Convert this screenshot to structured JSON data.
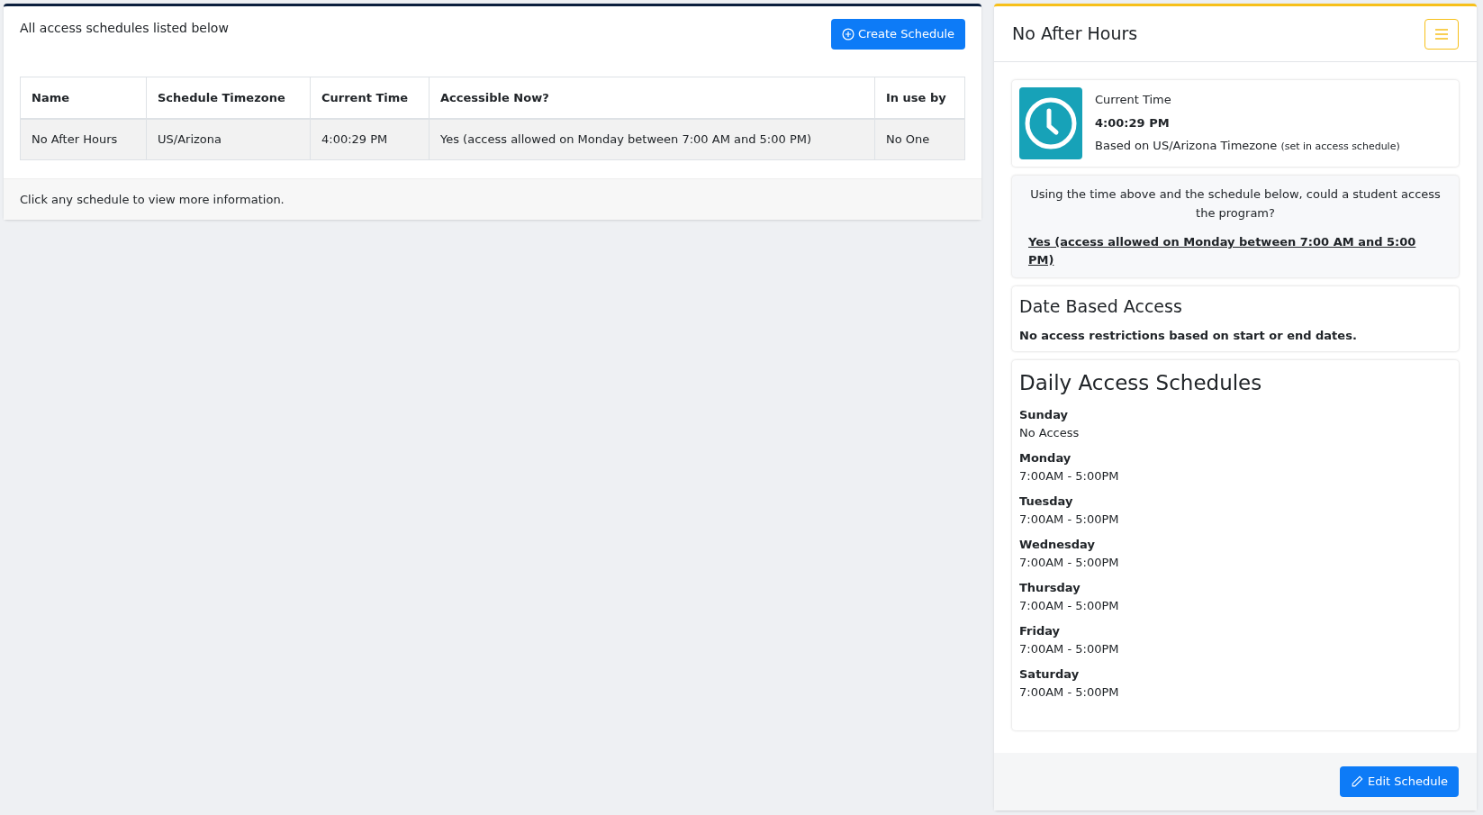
{
  "schedules_panel": {
    "heading": "All access schedules listed below",
    "create_button": "Create Schedule",
    "table": {
      "columns": [
        "Name",
        "Schedule Timezone",
        "Current Time",
        "Accessible Now?",
        "In use by"
      ],
      "rows": [
        [
          "No After Hours",
          "US/Arizona",
          "4:00:29 PM",
          "Yes (access allowed on Monday between 7:00 AM and 5:00 PM)",
          "No One"
        ]
      ]
    },
    "footer": "Click any schedule to view more information."
  },
  "detail_panel": {
    "title": "No After Hours",
    "time_card": {
      "label": "Current Time",
      "time": "4:00:29 PM",
      "timezone_note": "Based on US/Arizona Timezone",
      "timezone_aside": "(set in access schedule)"
    },
    "access_card": {
      "question": "Using the time above and the schedule below, could a student access the program?",
      "answer": "Yes (access allowed on Monday between 7:00 AM and 5:00 PM)"
    },
    "date_card": {
      "title": "Date Based Access",
      "text": "No access restrictions based on start or end dates."
    },
    "daily_card": {
      "title": "Daily Access Schedules",
      "days": [
        {
          "day": "Sunday",
          "hours": "No Access"
        },
        {
          "day": "Monday",
          "hours": "7:00AM - 5:00PM"
        },
        {
          "day": "Tuesday",
          "hours": "7:00AM - 5:00PM"
        },
        {
          "day": "Wednesday",
          "hours": "7:00AM - 5:00PM"
        },
        {
          "day": "Thursday",
          "hours": "7:00AM - 5:00PM"
        },
        {
          "day": "Friday",
          "hours": "7:00AM - 5:00PM"
        },
        {
          "day": "Saturday",
          "hours": "7:00AM - 5:00PM"
        }
      ]
    },
    "edit_button": "Edit Schedule"
  }
}
